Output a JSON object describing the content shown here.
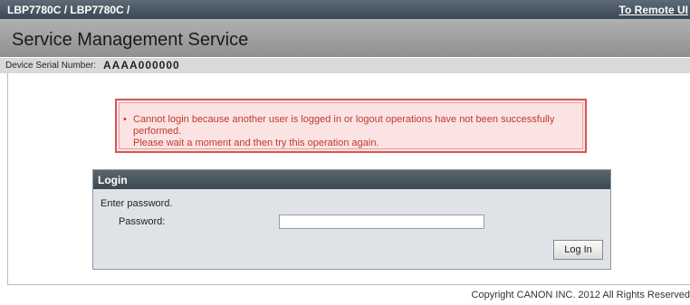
{
  "header": {
    "path": "LBP7780C / LBP7780C /",
    "remote_link": "To Remote UI"
  },
  "title": "Service Management Service",
  "serial": {
    "label": "Device Serial Number:",
    "value": "AAAA000000"
  },
  "error": {
    "line1": "Cannot login because another user is logged in or logout operations have not been successfully performed.",
    "line2": "Please wait a moment and then try this operation again."
  },
  "login": {
    "title": "Login",
    "instruction": "Enter password.",
    "password_label": "Password:",
    "password_value": "",
    "button_label": "Log In"
  },
  "footer": {
    "copyright": "Copyright CANON INC. 2012 All Rights Reserved"
  }
}
